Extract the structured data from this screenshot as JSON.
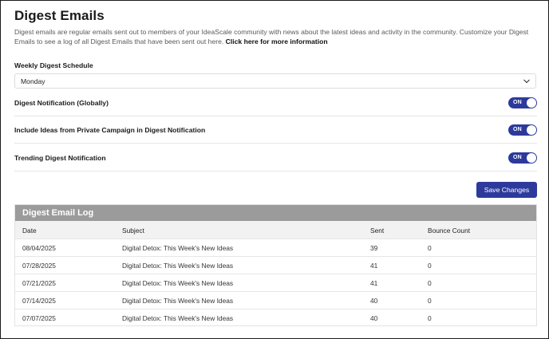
{
  "page": {
    "title": "Digest Emails",
    "description": "Digest emails are regular emails sent out to members of your IdeaScale community with news about the latest ideas and activity in the community. Customize your Digest Emails to see a log of all Digest Emails that have been sent out here.",
    "more_info_link": "Click here for more information"
  },
  "schedule": {
    "label": "Weekly Digest Schedule",
    "selected": "Monday",
    "icon": "chevron-down-icon"
  },
  "toggles": [
    {
      "label": "Digest Notification (Globally)",
      "state": "ON"
    },
    {
      "label": "Include Ideas from Private Campaign in Digest Notification",
      "state": "ON"
    },
    {
      "label": "Trending Digest Notification",
      "state": "ON"
    }
  ],
  "actions": {
    "save_label": "Save Changes"
  },
  "log": {
    "title": "Digest Email Log",
    "columns": [
      "Date",
      "Subject",
      "Sent",
      "Bounce Count"
    ],
    "rows": [
      {
        "date": "08/04/2025",
        "subject": "Digital Detox: This Week's New Ideas",
        "sent": "39",
        "bounce": "0"
      },
      {
        "date": "07/28/2025",
        "subject": "Digital Detox: This Week's New Ideas",
        "sent": "41",
        "bounce": "0"
      },
      {
        "date": "07/21/2025",
        "subject": "Digital Detox: This Week's New Ideas",
        "sent": "41",
        "bounce": "0"
      },
      {
        "date": "07/14/2025",
        "subject": "Digital Detox: This Week's New Ideas",
        "sent": "40",
        "bounce": "0"
      },
      {
        "date": "07/07/2025",
        "subject": "Digital Detox: This Week's New Ideas",
        "sent": "40",
        "bounce": "0"
      }
    ]
  },
  "colors": {
    "accent": "#2d3a9c",
    "log_header": "#9b9b9b"
  }
}
